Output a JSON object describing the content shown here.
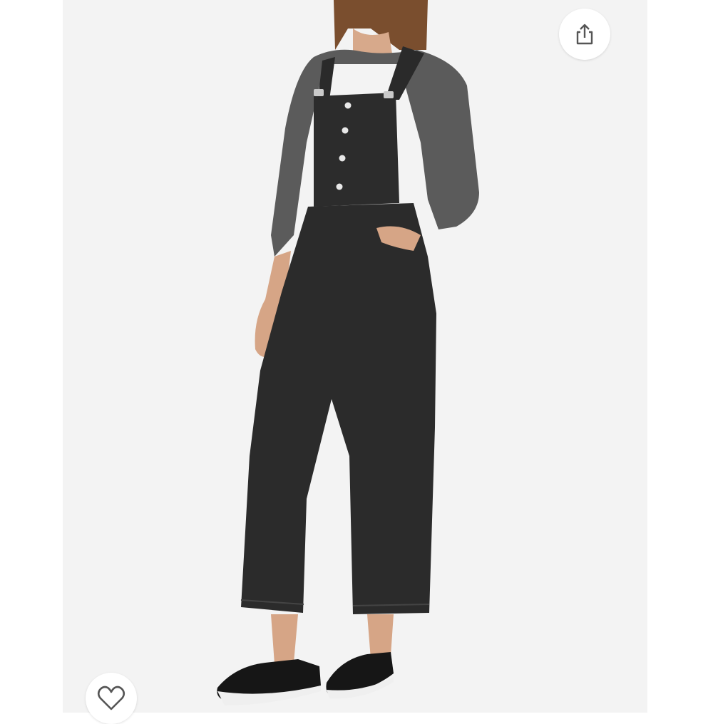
{
  "product_image": {
    "subject": "",
    "alt": ""
  },
  "actions": {
    "share_icon": "share-icon",
    "wishlist_icon": "heart-outline-icon"
  },
  "colors": {
    "background": "#f3f3f3",
    "denim": "#2b2b2b",
    "top": "#5a5a5a",
    "accent_icon": "#555555"
  }
}
